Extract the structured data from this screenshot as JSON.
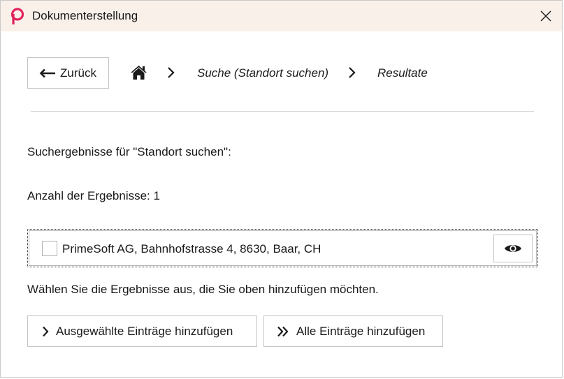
{
  "window": {
    "title": "Dokumenterstellung",
    "accent_color": "#e0245e",
    "titlebar_color": "#f9f0ea"
  },
  "nav": {
    "back_label": "Zurück",
    "breadcrumb": {
      "home_icon": "home-icon",
      "items": [
        "Suche (Standort suchen)",
        "Resultate"
      ]
    }
  },
  "content": {
    "results_heading": "Suchergebnisse für \"Standort suchen\":",
    "result_count": "Anzahl der Ergebnisse: 1",
    "results": [
      {
        "label": "PrimeSoft AG, Bahnhofstrasse 4, 8630, Baar, CH",
        "checked": false,
        "view_icon": "eye-icon"
      }
    ],
    "instruction": "Wählen Sie die Ergebnisse aus, die Sie oben hinzufügen möchten."
  },
  "actions": {
    "add_selected_label": "Ausgewählte Einträge hinzufügen",
    "add_all_label": "Alle Einträge hinzufügen"
  }
}
